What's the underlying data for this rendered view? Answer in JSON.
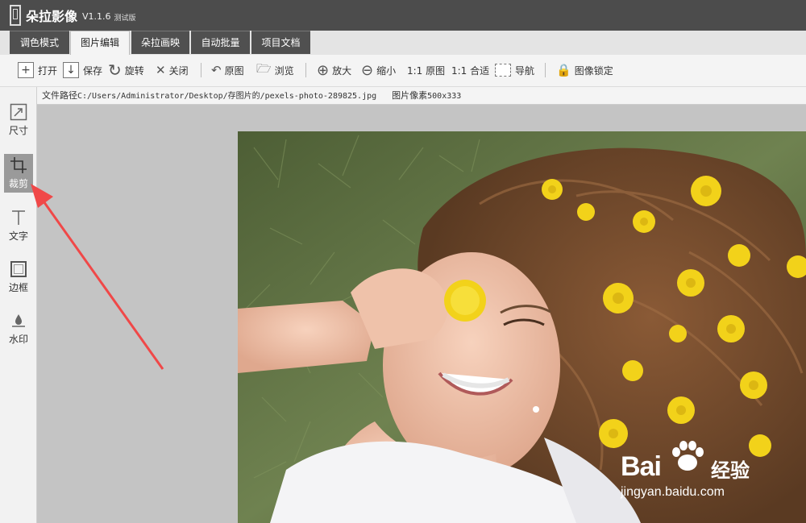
{
  "app": {
    "name": "朵拉影像",
    "version": "V1.1.6",
    "tag": "测试版"
  },
  "tabs": [
    {
      "label": "调色模式",
      "active": false
    },
    {
      "label": "图片编辑",
      "active": true
    },
    {
      "label": "朵拉画映",
      "active": false
    },
    {
      "label": "自动批量",
      "active": false
    },
    {
      "label": "项目文档",
      "active": false
    }
  ],
  "toolbar": {
    "open": "打开",
    "save": "保存",
    "rotate": "旋转",
    "close": "关闭",
    "original": "原图",
    "browse": "浏览",
    "zoom_in": "放大",
    "zoom_out": "缩小",
    "actual_size": "1:1 原图",
    "fit": "1:1 合适",
    "navigate": "导航",
    "lock": "图像锁定"
  },
  "sidebar": {
    "items": [
      {
        "label": "尺寸",
        "icon": "resize-icon",
        "active": false
      },
      {
        "label": "裁剪",
        "icon": "crop-icon",
        "active": true
      },
      {
        "label": "文字",
        "icon": "text-icon",
        "active": false
      },
      {
        "label": "边框",
        "icon": "border-icon",
        "active": false
      },
      {
        "label": "水印",
        "icon": "watermark-icon",
        "active": false
      }
    ]
  },
  "pathbar": {
    "path_label": "文件路径",
    "path_value": "C:/Users/Administrator/Desktop/存图片的/pexels-photo-289825.jpg",
    "pixels_label": "图片像素",
    "pixels_value": "500x333"
  },
  "watermark": {
    "brand": "Bai",
    "brand_suffix": "经验",
    "url": "jingyan.baidu.com"
  },
  "colors": {
    "titlebar": "#4c4c4c",
    "arrow": "#f04848",
    "flower": "#f2d21a"
  }
}
